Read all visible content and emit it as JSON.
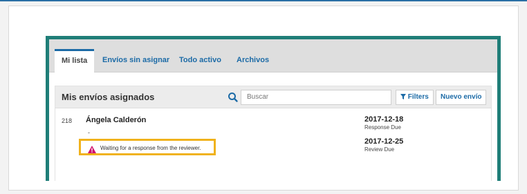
{
  "tabs": [
    {
      "label": "Mi lista",
      "active": true
    },
    {
      "label": "Envíos sin asignar",
      "active": false
    },
    {
      "label": "Todo activo",
      "active": false
    },
    {
      "label": "Archivos",
      "active": false
    }
  ],
  "panel": {
    "title": "Mis envíos asignados",
    "search_placeholder": "Buscar",
    "filters_label": "Filters",
    "new_submission_label": "Nuevo envío"
  },
  "submission": {
    "id": "218",
    "author": "Ángela Calderón",
    "subtitle": "-",
    "notice": "Waiting for a response from the reviewer.",
    "dates": [
      {
        "date": "2017-12-18",
        "label": "Response Due"
      },
      {
        "date": "2017-12-25",
        "label": "Review Due"
      }
    ]
  },
  "colors": {
    "accent": "#1b6aa6",
    "frame": "#1f7e78",
    "highlight": "#f0b21c",
    "warning": "#d0106b"
  },
  "icons": [
    "search-icon",
    "filter-icon",
    "warning-icon"
  ]
}
